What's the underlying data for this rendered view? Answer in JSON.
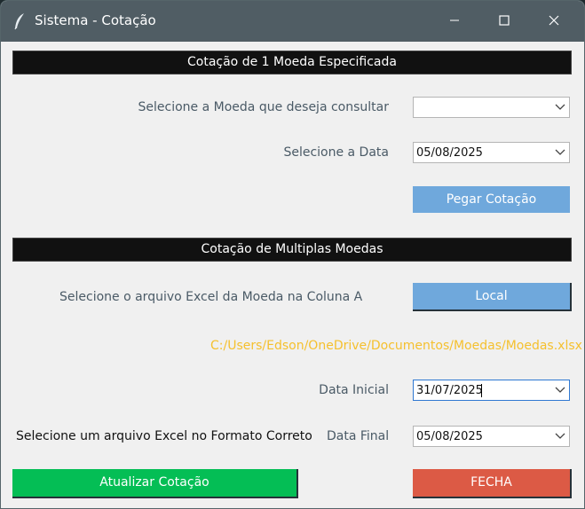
{
  "window": {
    "title": "Sistema - Cotação"
  },
  "section1": {
    "header": "Cotação de 1 Moeda Especificada",
    "currency_label": "Selecione a Moeda que deseja consultar",
    "currency_value": "",
    "date_label": "Selecione a Data",
    "date_value": "05/08/2025",
    "fetch_button": "Pegar Cotação"
  },
  "section2": {
    "header": "Cotação de Multiplas Moedas",
    "file_label": "Selecione o arquivo Excel da Moeda na Coluna A",
    "local_button": "Local",
    "file_path": "C:/Users/Edson/OneDrive/Documentos/Moedas/Moedas.xlsx",
    "start_label": "Data Inicial",
    "start_value": "31/07/2025",
    "status_message": "Selecione um arquivo Excel no Formato Correto",
    "end_label": "Data Final",
    "end_value": "05/08/2025",
    "update_button": "Atualizar Cotação",
    "close_button": "FECHA"
  },
  "colors": {
    "green": "#04be55",
    "red": "#dc5a45",
    "blue": "#6fa8dc",
    "path_yellow": "#f5c02e"
  }
}
